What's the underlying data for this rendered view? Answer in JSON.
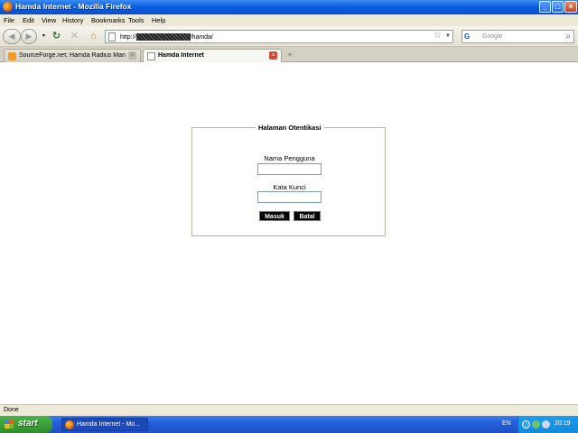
{
  "window": {
    "title": "Hamda Internet - Mozilla Firefox"
  },
  "menu": [
    "File",
    "Edit",
    "View",
    "History",
    "Bookmarks",
    "Tools",
    "Help"
  ],
  "nav": {
    "url_prefix": "http://",
    "url_suffix": "/hamda/",
    "search_placeholder": "Google",
    "search_engine": "G"
  },
  "tabs": [
    {
      "label": "SourceForge.net: Hamda Radius Mana...",
      "active": false
    },
    {
      "label": "Hamda Internet",
      "active": true
    }
  ],
  "form": {
    "legend": "Halaman Otentikasi",
    "username_label": "Nama Pengguna",
    "username_value": "",
    "password_label": "Kata Kunci",
    "password_value": "",
    "submit_label": "Masuk",
    "cancel_label": "Batal"
  },
  "status": {
    "text": "Done"
  },
  "taskbar": {
    "start_label": "start",
    "task_label": "Hamda Internet - Mo...",
    "language": "EN",
    "clock": "20:19"
  },
  "colors": {
    "titlebar": "#0a5fe0",
    "taskbar": "#245edb",
    "start": "#2b8d2a",
    "form_button": "#000000"
  }
}
